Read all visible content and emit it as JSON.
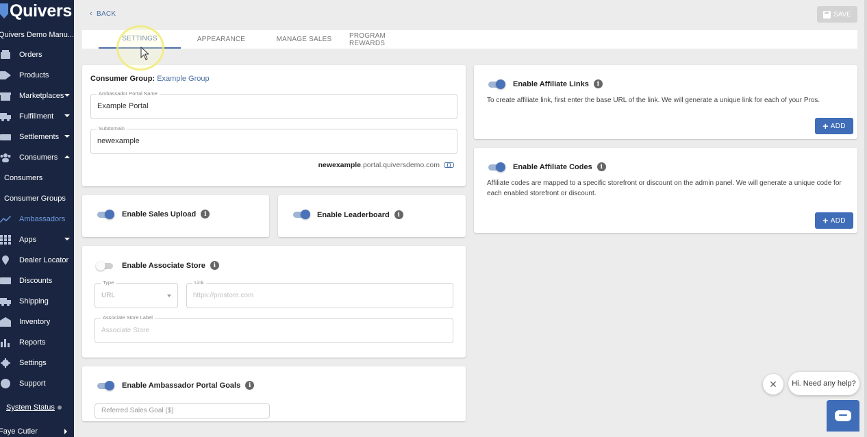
{
  "sidebar": {
    "logo": "Quivers",
    "org_name": "Quivers Demo Manu...",
    "items": [
      {
        "label": "Orders",
        "icon": "orders-icon"
      },
      {
        "label": "Products",
        "icon": "tag-icon"
      },
      {
        "label": "Marketplaces",
        "icon": "store-icon"
      },
      {
        "label": "Fulfillment",
        "icon": "truck-icon"
      },
      {
        "label": "Settlements",
        "icon": "money-icon"
      },
      {
        "label": "Consumers",
        "icon": "users-icon"
      },
      {
        "label": "Ambassadors",
        "icon": "chart-line-icon"
      },
      {
        "label": "Apps",
        "icon": "grid-icon"
      },
      {
        "label": "Dealer Locator",
        "icon": "map-pin-icon"
      },
      {
        "label": "Discounts",
        "icon": "ticket-icon"
      },
      {
        "label": "Shipping",
        "icon": "shipping-icon"
      },
      {
        "label": "Inventory",
        "icon": "warehouse-icon"
      },
      {
        "label": "Reports",
        "icon": "bar-chart-icon"
      },
      {
        "label": "Settings",
        "icon": "gear-icon"
      },
      {
        "label": "Support",
        "icon": "question-icon"
      }
    ],
    "sub_items": [
      "Consumers",
      "Consumer Groups"
    ],
    "system_status": "System Status",
    "user": "Faye Cutler"
  },
  "header": {
    "back": "BACK",
    "save": "SAVE"
  },
  "tabs": [
    "SETTINGS",
    "APPEARANCE",
    "MANAGE SALES",
    "PROGRAM REWARDS"
  ],
  "portal": {
    "consumer_group_label": "Consumer Group:",
    "consumer_group_value": "Example Group",
    "name_legend": "Ambassador Portal Name",
    "name_value": "Example Portal",
    "subdomain_legend": "Subdomain",
    "subdomain_value": "newexample",
    "url_sub": "newexample",
    "url_rest": ".portal.quiversdemo.com"
  },
  "toggles": {
    "sales_upload": "Enable Sales Upload",
    "leaderboard": "Enable Leaderboard",
    "associate_store": "Enable Associate Store",
    "portal_goals": "Enable Ambassador Portal Goals",
    "affiliate_links": "Enable Affiliate Links",
    "affiliate_codes": "Enable Affiliate Codes"
  },
  "associate_store": {
    "type_legend": "Type",
    "type_value": "URL",
    "link_legend": "Link",
    "link_placeholder": "https://prostore.com",
    "label_legend": "Associate Store Label",
    "label_placeholder": "Associate Store"
  },
  "goals": {
    "referred_sales_placeholder": "Referred Sales Goal ($)"
  },
  "affiliate_links": {
    "description": "To create affiliate link, first enter the base URL of the link. We will generate a unique link for each of your Pros.",
    "add": "ADD"
  },
  "affiliate_codes": {
    "description": "Affiliate codes are mapped to a specific storefront or discount on the admin panel. We will generate a unique code for each enabled storefront or discount.",
    "add": "ADD"
  },
  "help": {
    "close": "✕",
    "bubble": "Hi. Need any help?"
  },
  "colors": {
    "sidebar_bg": "#1a2641",
    "accent": "#3f6db8",
    "link": "#4a6fa5"
  }
}
